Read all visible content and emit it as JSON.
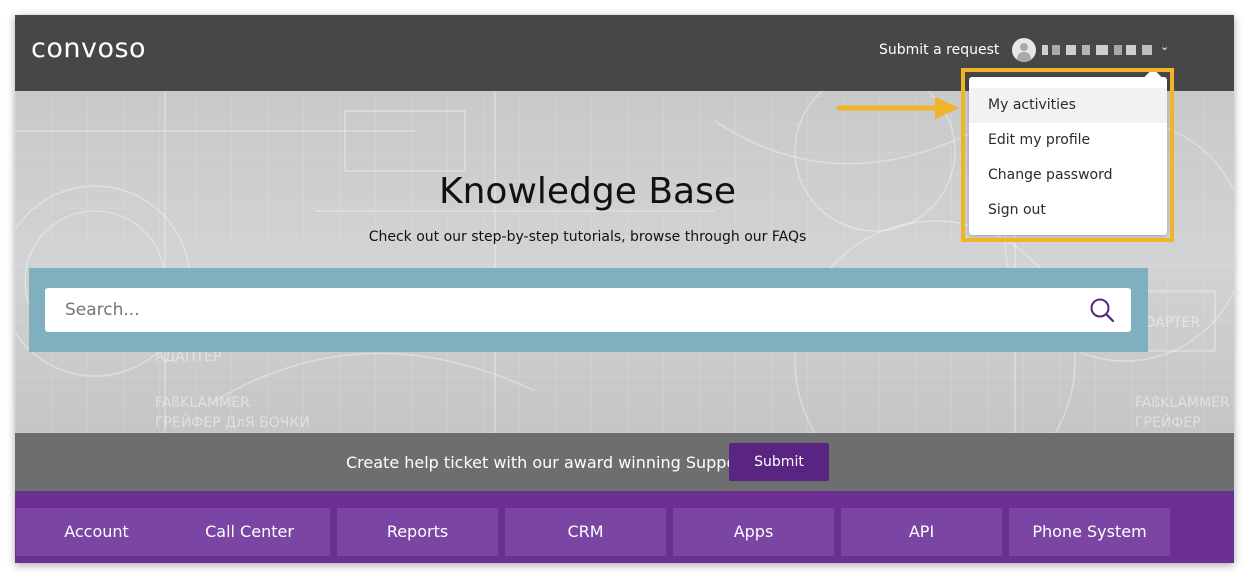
{
  "header": {
    "logo": "convoso",
    "submit_request": "Submit a request"
  },
  "hero": {
    "title": "Knowledge Base",
    "subtitle": "Check out our step-by-step tutorials, browse through our FAQs"
  },
  "search": {
    "placeholder": "Search..."
  },
  "ticket": {
    "text": "Create help ticket with our award winning Support",
    "button": "Submit"
  },
  "categories": [
    "Account",
    "Call Center",
    "Reports",
    "CRM",
    "Apps",
    "API",
    "Phone System"
  ],
  "user_menu": {
    "items": [
      "My activities",
      "Edit my profile",
      "Change password",
      "Sign out"
    ]
  },
  "colors": {
    "header": "#474747",
    "accent_purple": "#6b3092",
    "button_purple": "#5a2582",
    "search_band": "#7fb0c0",
    "annotation": "#f0b429"
  },
  "icons": {
    "search": "search-icon",
    "user": "user-avatar-icon",
    "chevron": "chevron-down-icon"
  }
}
